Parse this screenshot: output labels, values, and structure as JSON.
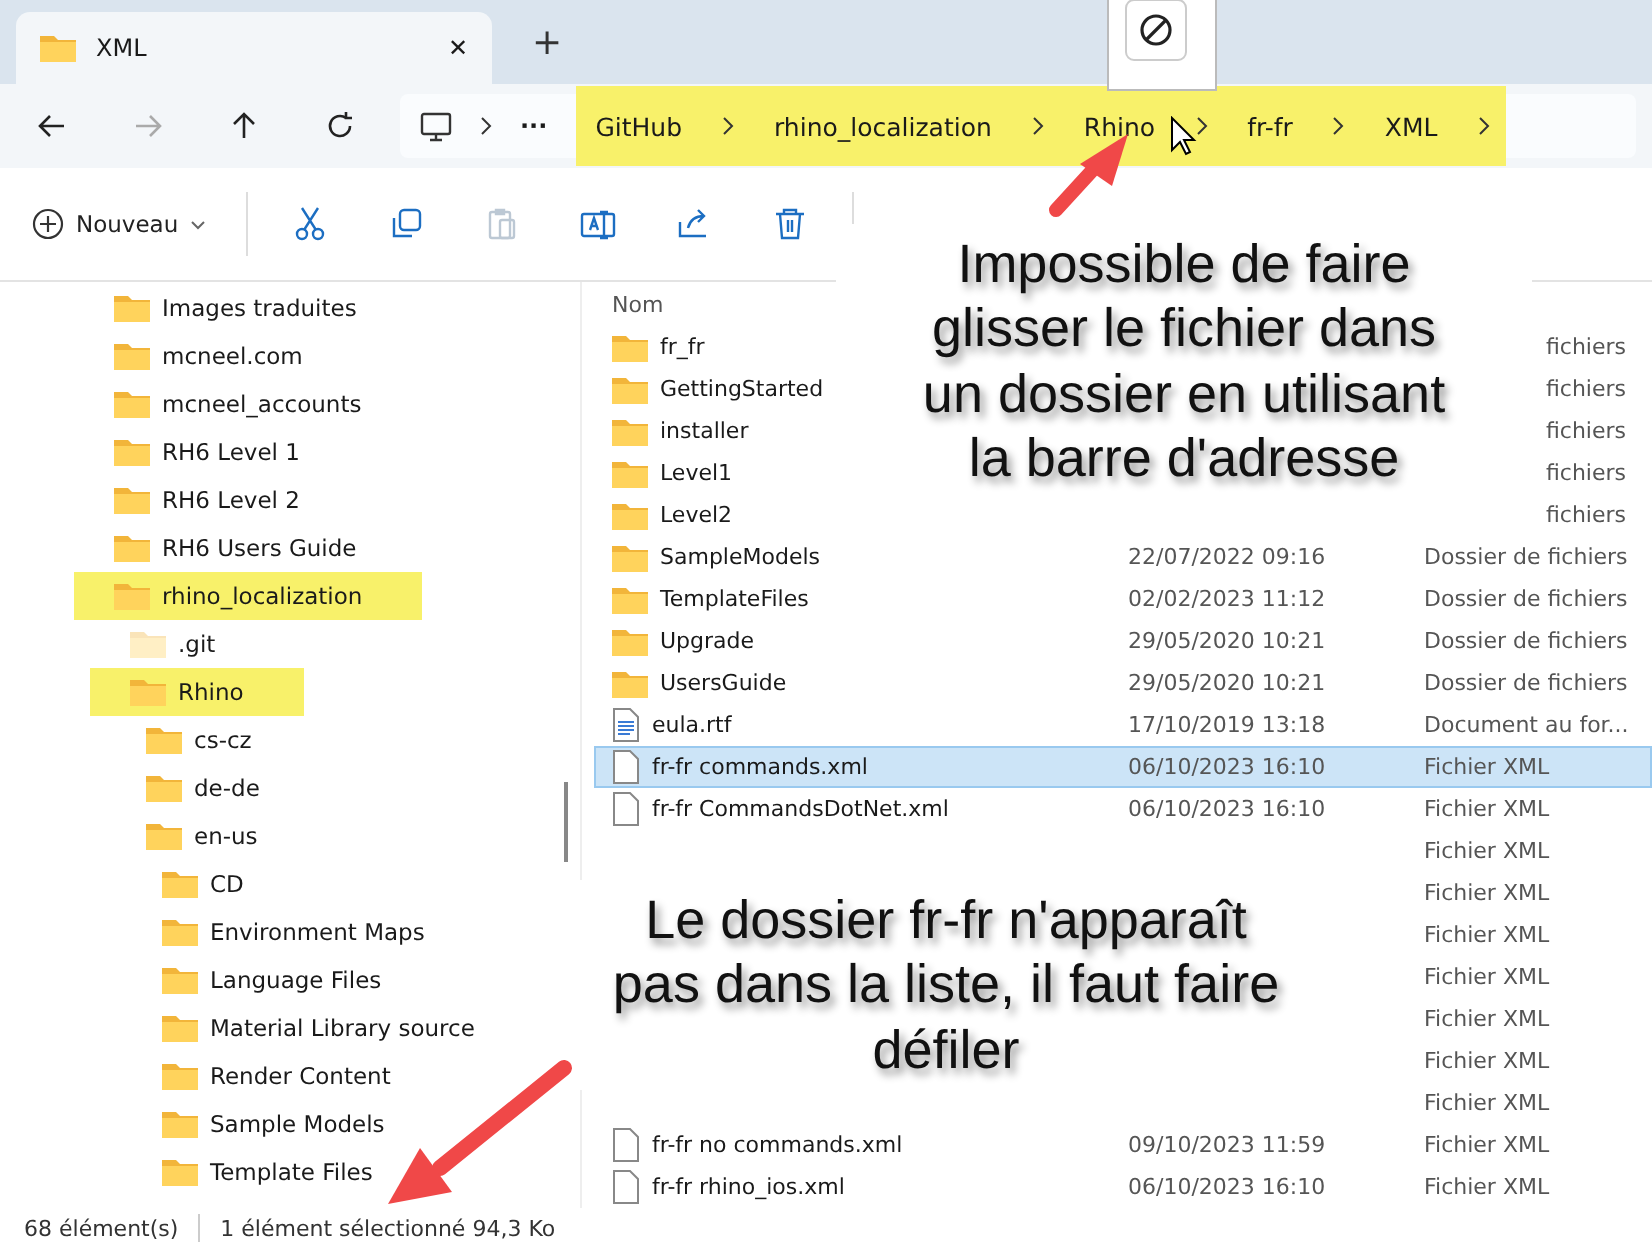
{
  "window_tab": {
    "title": "XML",
    "close": "✕",
    "new_tab": "+"
  },
  "navigation": [
    {
      "kind": "back",
      "disabled": false
    },
    {
      "kind": "forward",
      "disabled": true
    },
    {
      "kind": "up",
      "disabled": false
    },
    {
      "kind": "refresh",
      "disabled": false
    }
  ],
  "address_bar": {
    "overflow": "···",
    "highlighted": true,
    "crumbs": [
      "GitHub",
      "rhino_localization",
      "Rhino",
      "fr-fr",
      "XML"
    ]
  },
  "toolbar": {
    "new_button": "Nouveau",
    "tools": [
      {
        "kind": "cut",
        "disabled": false
      },
      {
        "kind": "copy",
        "disabled": false
      },
      {
        "kind": "paste",
        "disabled": true
      },
      {
        "kind": "rename",
        "disabled": false
      },
      {
        "kind": "share",
        "disabled": false
      },
      {
        "kind": "delete",
        "disabled": false
      }
    ]
  },
  "sidebar": {
    "items": [
      {
        "label": "Images traduites",
        "highlighted": false,
        "hidden": false
      },
      {
        "label": "mcneel.com",
        "highlighted": false,
        "hidden": false
      },
      {
        "label": "mcneel_accounts",
        "highlighted": false,
        "hidden": false
      },
      {
        "label": "RH6 Level 1",
        "highlighted": false,
        "hidden": false
      },
      {
        "label": "RH6 Level 2",
        "highlighted": false,
        "hidden": false
      },
      {
        "label": "RH6 Users Guide",
        "highlighted": false,
        "hidden": false
      },
      {
        "label": "rhino_localization",
        "highlighted": true,
        "hidden": false,
        "children": [
          {
            "label": ".git",
            "highlighted": false,
            "hidden": true
          },
          {
            "label": "Rhino",
            "highlighted": true,
            "hidden": false,
            "children": [
              {
                "label": "cs-cz",
                "highlighted": false,
                "hidden": false
              },
              {
                "label": "de-de",
                "highlighted": false,
                "hidden": false
              },
              {
                "label": "en-us",
                "highlighted": false,
                "hidden": false,
                "children": [
                  {
                    "label": "CD",
                    "highlighted": false,
                    "hidden": false
                  },
                  {
                    "label": "Environment Maps",
                    "highlighted": false,
                    "hidden": false
                  },
                  {
                    "label": "Language Files",
                    "highlighted": false,
                    "hidden": false
                  },
                  {
                    "label": "Material Library source",
                    "highlighted": false,
                    "hidden": false
                  },
                  {
                    "label": "Render Content",
                    "highlighted": false,
                    "hidden": false
                  },
                  {
                    "label": "Sample Models",
                    "highlighted": false,
                    "hidden": false
                  },
                  {
                    "label": "Template Files",
                    "highlighted": false,
                    "hidden": false
                  }
                ]
              }
            ]
          }
        ]
      }
    ]
  },
  "file_list": {
    "columns": [
      "Nom"
    ],
    "rows": [
      {
        "kind": "folder",
        "name": "fr_fr",
        "type": "fichiers",
        "selected": false
      },
      {
        "kind": "folder",
        "name": "GettingStarted",
        "type": "fichiers",
        "selected": false
      },
      {
        "kind": "folder",
        "name": "installer",
        "type": "fichiers",
        "selected": false
      },
      {
        "kind": "folder",
        "name": "Level1",
        "type": "fichiers",
        "selected": false
      },
      {
        "kind": "folder",
        "name": "Level2",
        "type": "fichiers",
        "selected": false
      },
      {
        "kind": "folder",
        "name": "SampleModels",
        "date": "22/07/2022 09:16",
        "type": "Dossier de fichiers",
        "selected": false
      },
      {
        "kind": "folder",
        "name": "TemplateFiles",
        "date": "02/02/2023 11:12",
        "type": "Dossier de fichiers",
        "selected": false
      },
      {
        "kind": "folder",
        "name": "Upgrade",
        "date": "29/05/2020 10:21",
        "type": "Dossier de fichiers",
        "selected": false
      },
      {
        "kind": "folder",
        "name": "UsersGuide",
        "date": "29/05/2020 10:21",
        "type": "Dossier de fichiers",
        "selected": false
      },
      {
        "kind": "rtf",
        "name": "eula.rtf",
        "date": "17/10/2019 13:18",
        "type": "Document au for...",
        "selected": false
      },
      {
        "kind": "xml",
        "name": "fr-fr commands.xml",
        "date": "06/10/2023 16:10",
        "type": "Fichier XML",
        "selected": true
      },
      {
        "kind": "xml",
        "name": "fr-fr CommandsDotNet.xml",
        "date": "06/10/2023 16:10",
        "type": "Fichier XML",
        "selected": false
      },
      {
        "kind": "none",
        "type": "Fichier XML",
        "selected": false
      },
      {
        "kind": "none",
        "type": "Fichier XML",
        "selected": false
      },
      {
        "kind": "none",
        "type": "Fichier XML",
        "selected": false
      },
      {
        "kind": "none",
        "type": "Fichier XML",
        "selected": false
      },
      {
        "kind": "none",
        "type": "Fichier XML",
        "selected": false
      },
      {
        "kind": "none",
        "type": "Fichier XML",
        "selected": false
      },
      {
        "kind": "none",
        "type": "Fichier XML",
        "selected": false
      },
      {
        "kind": "xml",
        "name": "fr-fr no commands.xml",
        "date": "09/10/2023 11:59",
        "type": "Fichier XML",
        "selected": false
      },
      {
        "kind": "xml",
        "name": "fr-fr rhino_ios.xml",
        "date": "06/10/2023 16:10",
        "type": "Fichier XML",
        "selected": false
      }
    ]
  },
  "status_bar": {
    "count": "68 élément(s)",
    "selection": "1 élément sélectionné  94,3 Ko"
  },
  "annotations": [
    {
      "kind": "top",
      "lines": [
        "Impossible de faire",
        "glisser le fichier dans",
        "un dossier en utilisant",
        "la barre d'adresse"
      ]
    },
    {
      "kind": "bottom",
      "lines": [
        "Le dossier fr-fr n'apparaît",
        "pas dans la liste, il faut faire",
        "défiler"
      ]
    }
  ]
}
